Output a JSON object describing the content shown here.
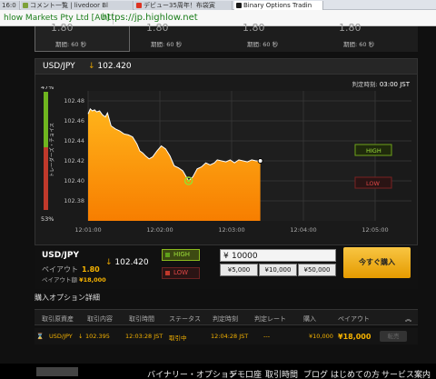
{
  "browser": {
    "tabs": [
      {
        "label": "16:0"
      },
      {
        "label": "コメント一覧 | livedoor Bl"
      },
      {
        "label": "デビュー35周年！布袋寅"
      },
      {
        "label": "Binary Options Tradin"
      }
    ],
    "cert_label": "hlow Markets Pty Ltd [AU]",
    "url": "https://jp.highlow.net"
  },
  "expiry_strip": {
    "items": [
      {
        "value": "1.80",
        "label": "期間: 60 秒"
      },
      {
        "value": "1.80",
        "label": "期間: 60 秒"
      },
      {
        "value": "1.80",
        "label": "期間: 60 秒"
      },
      {
        "value": "1.80",
        "label": "期間: 60 秒"
      }
    ]
  },
  "chart_panel": {
    "pair": "USD/JPY",
    "price": "102.420",
    "judgement_time_label": "判定時刻:",
    "judgement_time": "03:00 JST",
    "sentiment_label": "トレーダーズ・チョイス",
    "sentiment_high": "47%",
    "sentiment_low": "53%",
    "high_label": "HIGH",
    "low_label": "LOW"
  },
  "chart_data": {
    "type": "area",
    "x": [
      "12:01:00",
      "12:02:00",
      "12:03:00",
      "12:04:00",
      "12:05:00"
    ],
    "yticks": [
      "102.48",
      "102.46",
      "102.44",
      "102.42",
      "102.40",
      "102.38"
    ],
    "ylim": [
      102.36,
      102.49
    ],
    "points": [
      [
        0,
        102.467
      ],
      [
        0.03,
        102.472
      ],
      [
        0.06,
        102.47
      ],
      [
        0.09,
        102.471
      ],
      [
        0.12,
        102.469
      ],
      [
        0.16,
        102.47
      ],
      [
        0.2,
        102.466
      ],
      [
        0.24,
        102.464
      ],
      [
        0.27,
        102.468
      ],
      [
        0.32,
        102.455
      ],
      [
        0.38,
        102.452
      ],
      [
        0.44,
        102.45
      ],
      [
        0.5,
        102.447
      ],
      [
        0.56,
        102.446
      ],
      [
        0.62,
        102.444
      ],
      [
        0.68,
        102.437
      ],
      [
        0.72,
        102.43
      ],
      [
        0.76,
        102.428
      ],
      [
        0.8,
        102.425
      ],
      [
        0.85,
        102.422
      ],
      [
        0.9,
        102.424
      ],
      [
        0.96,
        102.43
      ],
      [
        1.02,
        102.435
      ],
      [
        1.08,
        102.432
      ],
      [
        1.14,
        102.425
      ],
      [
        1.2,
        102.415
      ],
      [
        1.26,
        102.413
      ],
      [
        1.32,
        102.41
      ],
      [
        1.36,
        102.405
      ],
      [
        1.4,
        102.4
      ],
      [
        1.46,
        102.404
      ],
      [
        1.52,
        102.412
      ],
      [
        1.58,
        102.414
      ],
      [
        1.64,
        102.418
      ],
      [
        1.7,
        102.416
      ],
      [
        1.76,
        102.418
      ],
      [
        1.8,
        102.421
      ],
      [
        1.86,
        102.42
      ],
      [
        1.92,
        102.419
      ],
      [
        1.98,
        102.421
      ],
      [
        2.04,
        102.418
      ],
      [
        2.1,
        102.421
      ],
      [
        2.16,
        102.42
      ],
      [
        2.22,
        102.419
      ],
      [
        2.28,
        102.421
      ],
      [
        2.34,
        102.42
      ],
      [
        2.4,
        102.42
      ]
    ],
    "strike_point": [
      1.4,
      102.4
    ],
    "color": "#f7a51e"
  },
  "trade": {
    "pair": "USD/JPY",
    "price": "102.420",
    "payout_label": "ペイアウト",
    "payout_value": "1.80",
    "payout_amount_label": "ペイアウト額",
    "payout_amount": "¥18,000",
    "high_label": "HIGH",
    "low_label": "LOW",
    "amount_value": "10000",
    "chips": [
      "¥5,000",
      "¥10,000",
      "¥50,000"
    ],
    "buy_label": "今すぐ購入"
  },
  "details": {
    "title": "購入オプション詳細",
    "headers": [
      "取引原資産",
      "取引内容",
      "取引時間",
      "ステータス",
      "判定時刻",
      "判定レート",
      "購入",
      "ペイアウト"
    ],
    "row": {
      "asset": "USD/JPY",
      "rate": "102.395",
      "time": "12:03:28 JST",
      "status": "取引中",
      "judge_time": "12:04:28 JST",
      "judge_rate": "---",
      "purchase": "¥10,000",
      "payout": "¥18,000",
      "action": "転売"
    }
  },
  "footer": {
    "items": [
      "バイナリー・オプション",
      "デモ口座",
      "取引時間",
      "ブログ",
      "はじめての方",
      "サービス案内"
    ]
  }
}
